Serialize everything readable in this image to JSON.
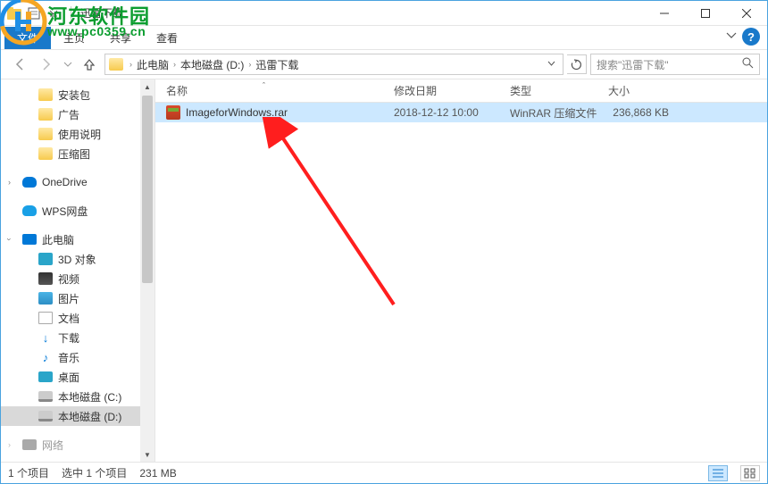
{
  "window": {
    "title": "迅雷下载",
    "min_tip": "最小化",
    "max_tip": "最大化",
    "close_tip": "关闭"
  },
  "ribbon": {
    "file": "文件",
    "tabs": [
      "主页",
      "共享",
      "查看"
    ]
  },
  "address": {
    "segments": [
      "此电脑",
      "本地磁盘 (D:)",
      "迅雷下载"
    ],
    "search_placeholder": "搜索\"迅雷下载\""
  },
  "nav": {
    "quick": [
      "安装包",
      "广告",
      "使用说明",
      "压缩图"
    ],
    "onedrive": "OneDrive",
    "wps": "WPS网盘",
    "thispc": "此电脑",
    "pc_children": [
      "3D 对象",
      "视频",
      "图片",
      "文档",
      "下载",
      "音乐",
      "桌面",
      "本地磁盘 (C:)",
      "本地磁盘 (D:)"
    ],
    "network": "网络"
  },
  "columns": {
    "name": "名称",
    "date": "修改日期",
    "type": "类型",
    "size": "大小"
  },
  "files": [
    {
      "name": "ImageforWindows.rar",
      "date": "2018-12-12 10:00",
      "type": "WinRAR 压缩文件",
      "size": "236,868 KB"
    }
  ],
  "status": {
    "items": "1 个项目",
    "selected": "选中 1 个项目",
    "sel_size": "231 MB"
  },
  "watermark": {
    "line1": "河东软件园",
    "line2": "www.pc0359.cn"
  }
}
